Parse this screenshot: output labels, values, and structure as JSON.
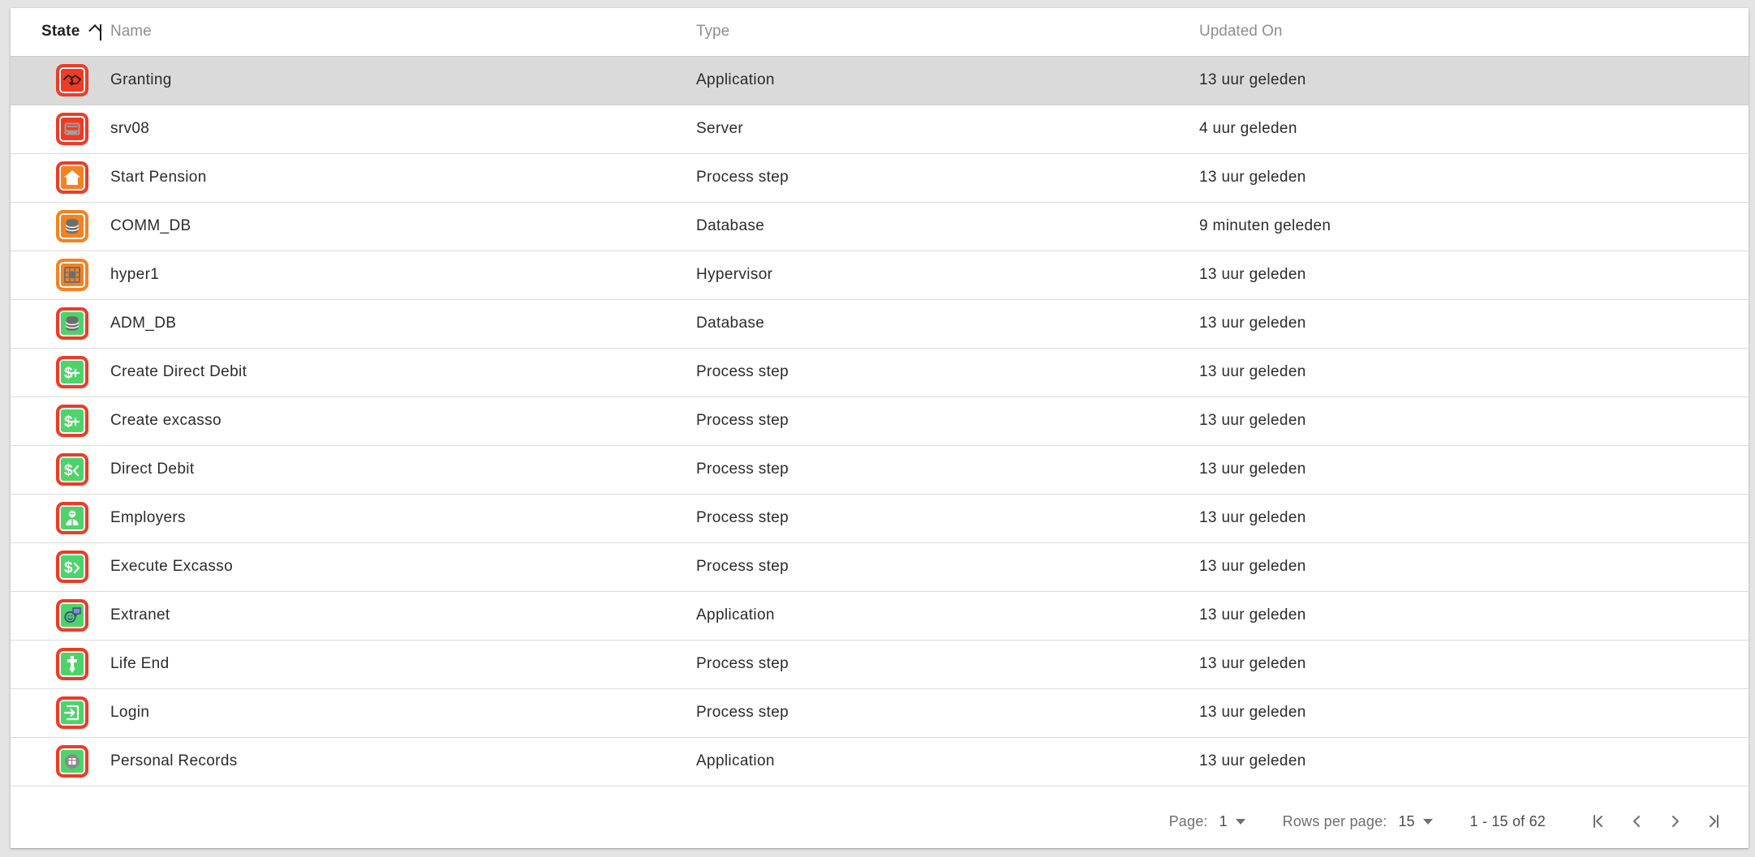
{
  "table": {
    "columns": [
      {
        "key": "state",
        "label": "State",
        "sorted": true,
        "sort_dir": "asc"
      },
      {
        "key": "name",
        "label": "Name",
        "sorted": false
      },
      {
        "key": "type",
        "label": "Type",
        "sorted": false
      },
      {
        "key": "updated",
        "label": "Updated On",
        "sorted": false
      }
    ],
    "rows": [
      {
        "icon": "handshake-icon",
        "ring": "#ef3b24",
        "fill": "#ef3b24",
        "glyph": "#1f1f1f",
        "name": "Granting",
        "type": "Application",
        "updated": "13 uur geleden",
        "selected": true
      },
      {
        "icon": "server-icon",
        "ring": "#ef3b24",
        "fill": "#ef3b24",
        "glyph": "#9e9e9e",
        "name": "srv08",
        "type": "Server",
        "updated": "4 uur geleden",
        "selected": false
      },
      {
        "icon": "home-icon",
        "ring": "#ef3b24",
        "fill": "#f58220",
        "glyph": "#ffffff",
        "name": "Start Pension",
        "type": "Process step",
        "updated": "13 uur geleden",
        "selected": false
      },
      {
        "icon": "database-icon",
        "ring": "#f58220",
        "fill": "#f58220",
        "glyph": "#6e6e6e",
        "name": "COMM_DB",
        "type": "Database",
        "updated": "9 minuten geleden",
        "selected": false
      },
      {
        "icon": "hypervisor-icon",
        "ring": "#f58220",
        "fill": "#f58220",
        "glyph": "#6e6e6e",
        "name": "hyper1",
        "type": "Hypervisor",
        "updated": "13 uur geleden",
        "selected": false
      },
      {
        "icon": "database-icon",
        "ring": "#ef3b24",
        "fill": "#4ed36a",
        "glyph": "#6e6e6e",
        "name": "ADM_DB",
        "type": "Database",
        "updated": "13 uur geleden",
        "selected": false
      },
      {
        "icon": "money-add-icon",
        "ring": "#ef3b24",
        "fill": "#4ed36a",
        "glyph": "#ffffff",
        "name": "Create Direct Debit",
        "type": "Process step",
        "updated": "13 uur geleden",
        "selected": false
      },
      {
        "icon": "money-add-icon",
        "ring": "#ef3b24",
        "fill": "#4ed36a",
        "glyph": "#ffffff",
        "name": "Create excasso",
        "type": "Process step",
        "updated": "13 uur geleden",
        "selected": false
      },
      {
        "icon": "money-in-icon",
        "ring": "#ef3b24",
        "fill": "#4ed36a",
        "glyph": "#ffffff",
        "name": "Direct Debit",
        "type": "Process step",
        "updated": "13 uur geleden",
        "selected": false
      },
      {
        "icon": "person-icon",
        "ring": "#ef3b24",
        "fill": "#4ed36a",
        "glyph": "#ffffff",
        "name": "Employers",
        "type": "Process step",
        "updated": "13 uur geleden",
        "selected": false
      },
      {
        "icon": "money-out-icon",
        "ring": "#ef3b24",
        "fill": "#4ed36a",
        "glyph": "#ffffff",
        "name": "Execute Excasso",
        "type": "Process step",
        "updated": "13 uur geleden",
        "selected": false
      },
      {
        "icon": "chat-smiley-icon",
        "ring": "#ef3b24",
        "fill": "#4ed36a",
        "glyph": "#3d4f80",
        "name": "Extranet",
        "type": "Application",
        "updated": "13 uur geleden",
        "selected": false
      },
      {
        "icon": "cross-icon",
        "ring": "#ef3b24",
        "fill": "#4ed36a",
        "glyph": "#ffffff",
        "name": "Life End",
        "type": "Process step",
        "updated": "13 uur geleden",
        "selected": false
      },
      {
        "icon": "login-icon",
        "ring": "#ef3b24",
        "fill": "#4ed36a",
        "glyph": "#ffffff",
        "name": "Login",
        "type": "Process step",
        "updated": "13 uur geleden",
        "selected": false
      },
      {
        "icon": "records-icon",
        "ring": "#ef3b24",
        "fill": "#4ed36a",
        "glyph": "#8a8a8a",
        "name": "Personal Records",
        "type": "Application",
        "updated": "13 uur geleden",
        "selected": false
      }
    ]
  },
  "paginator": {
    "page_label": "Page:",
    "page_value": "1",
    "rows_per_page_label": "Rows per page:",
    "rows_per_page_value": "15",
    "range_label": "1 - 15 of 62",
    "first_page_icon": "first-page-icon",
    "prev_page_icon": "previous-page-icon",
    "next_page_icon": "next-page-icon",
    "last_page_icon": "last-page-icon"
  },
  "colors": {
    "selected_row": "#dadada",
    "page_background": "#e4e4e4",
    "card_background": "#ffffff",
    "red": "#ef3b24",
    "orange": "#f58220",
    "green": "#4ed36a"
  }
}
